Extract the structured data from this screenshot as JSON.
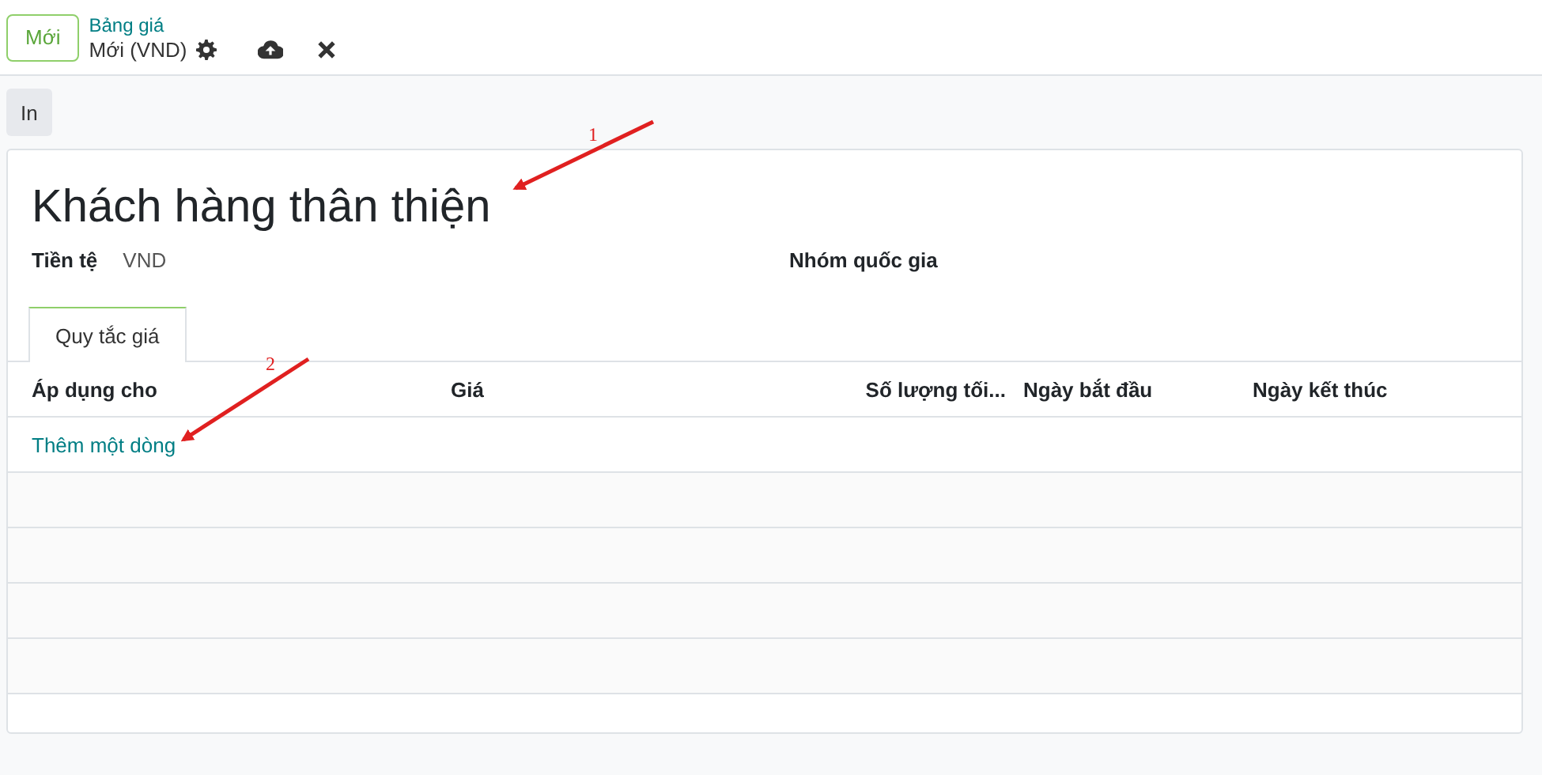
{
  "control_panel": {
    "new_button": "Mới",
    "breadcrumb": "Bảng giá",
    "record_name": "Mới (VND)"
  },
  "action_buttons": [
    "In"
  ],
  "form": {
    "name": "Khách hàng thân thiện",
    "fields": [
      {
        "label": "Tiền tệ",
        "value": "VND"
      },
      {
        "label": "Nhóm quốc gia"
      }
    ]
  },
  "tabs": [
    {
      "label": "Quy tắc giá",
      "selected": true
    }
  ],
  "table": {
    "columns": [
      "Áp dụng cho",
      "Giá",
      "Số lượng tối...",
      "Ngày bắt đầu",
      "Ngày kết thúc"
    ],
    "add_line": "Thêm một dòng"
  },
  "annotations": [
    {
      "label": "1"
    },
    {
      "label": "2"
    }
  ]
}
